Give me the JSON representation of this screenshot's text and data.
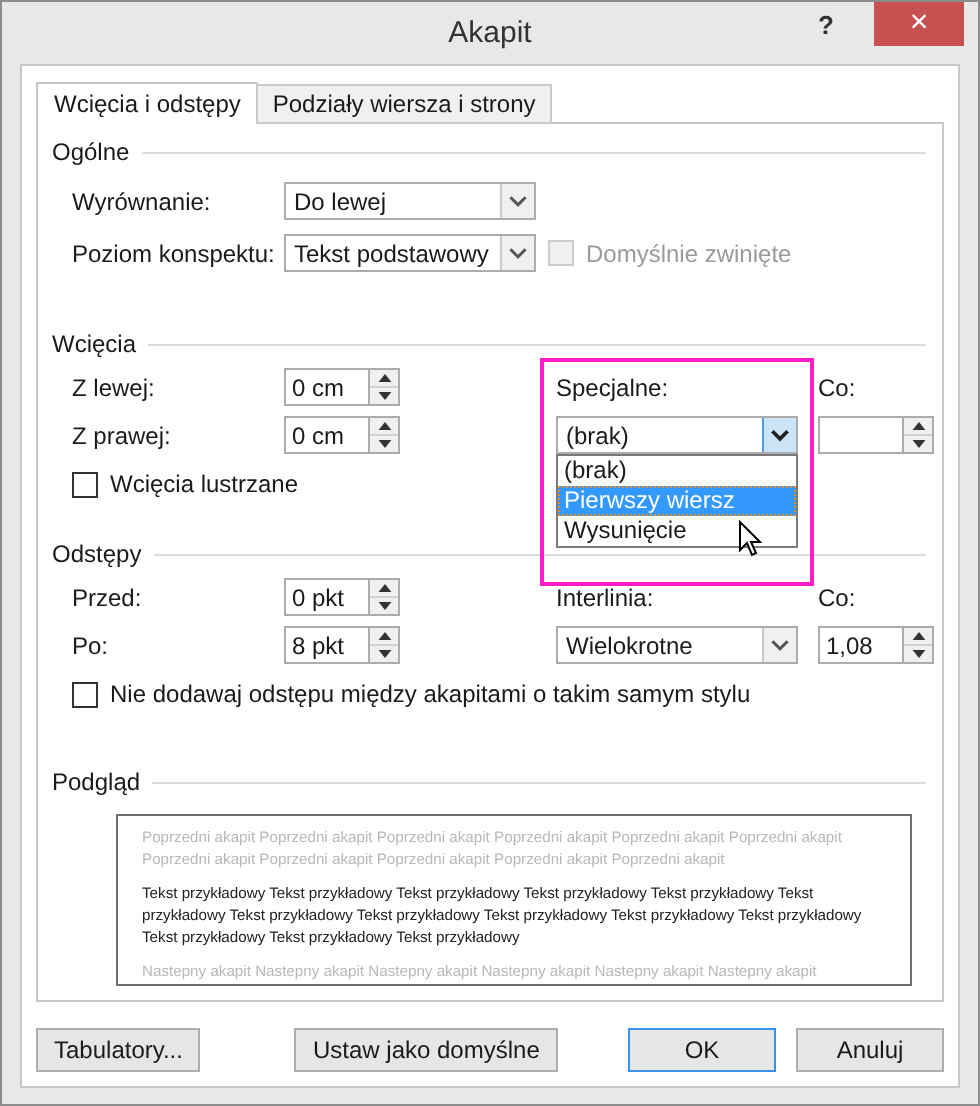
{
  "window": {
    "title": "Akapit",
    "help": "?",
    "close": "×"
  },
  "tabs": [
    {
      "label": "Wcięcia i odstępy",
      "selected": true
    },
    {
      "label": "Podziały wiersza i strony",
      "selected": false
    }
  ],
  "general": {
    "heading": "Ogólne",
    "alignment": {
      "label": "Wyrównanie:",
      "value": "Do lewej"
    },
    "outline_level": {
      "label": "Poziom konspektu:",
      "value": "Tekst podstawowy"
    },
    "collapsed": {
      "label": "Domyślnie zwinięte",
      "checked": false,
      "disabled": true
    }
  },
  "indentation": {
    "heading": "Wcięcia",
    "left": {
      "label": "Z lewej:",
      "value": "0 cm"
    },
    "right": {
      "label": "Z prawej:",
      "value": "0 cm"
    },
    "special": {
      "label": "Specjalne:",
      "value": "(brak)",
      "expanded": true,
      "options": [
        {
          "label": "(brak)",
          "highlighted": false
        },
        {
          "label": "Pierwszy wiersz",
          "highlighted": true
        },
        {
          "label": "Wysunięcie",
          "highlighted": false
        }
      ]
    },
    "by": {
      "label": "Co:"
    },
    "mirror": {
      "label": "Wcięcia lustrzane",
      "checked": false
    }
  },
  "spacing": {
    "heading": "Odstępy",
    "before": {
      "label": "Przed:",
      "value": "0 pkt"
    },
    "after": {
      "label": "Po:",
      "value": "8 pkt"
    },
    "line_spacing": {
      "label": "Interlinia:",
      "value": "Wielokrotne"
    },
    "at": {
      "label": "Co:",
      "value": "1,08"
    },
    "no_space": {
      "label": "Nie dodawaj odstępu między akapitami o takim samym stylu",
      "checked": false
    }
  },
  "preview": {
    "heading": "Podgląd",
    "previous": "Poprzedni akapit Poprzedni akapit Poprzedni akapit Poprzedni akapit Poprzedni akapit Poprzedni akapit Poprzedni akapit Poprzedni akapit Poprzedni akapit Poprzedni akapit Poprzedni akapit",
    "sample": "Tekst przykładowy Tekst przykładowy Tekst przykładowy Tekst przykładowy Tekst przykładowy Tekst przykładowy Tekst przykładowy Tekst przykładowy Tekst przykładowy Tekst przykładowy Tekst przykładowy Tekst przykładowy Tekst przykładowy Tekst przykładowy",
    "next": "Nastepny akapit Nastepny akapit Nastepny akapit Nastepny akapit Nastepny akapit Nastepny akapit"
  },
  "buttons": [
    {
      "label": "Tabulatory...",
      "default": false,
      "kind": "left"
    },
    {
      "label": "Ustaw jako domyślne",
      "default": false,
      "kind": "left"
    },
    {
      "label": "OK",
      "default": true,
      "kind": "right"
    },
    {
      "label": "Anuluj",
      "default": false,
      "kind": "right"
    }
  ]
}
